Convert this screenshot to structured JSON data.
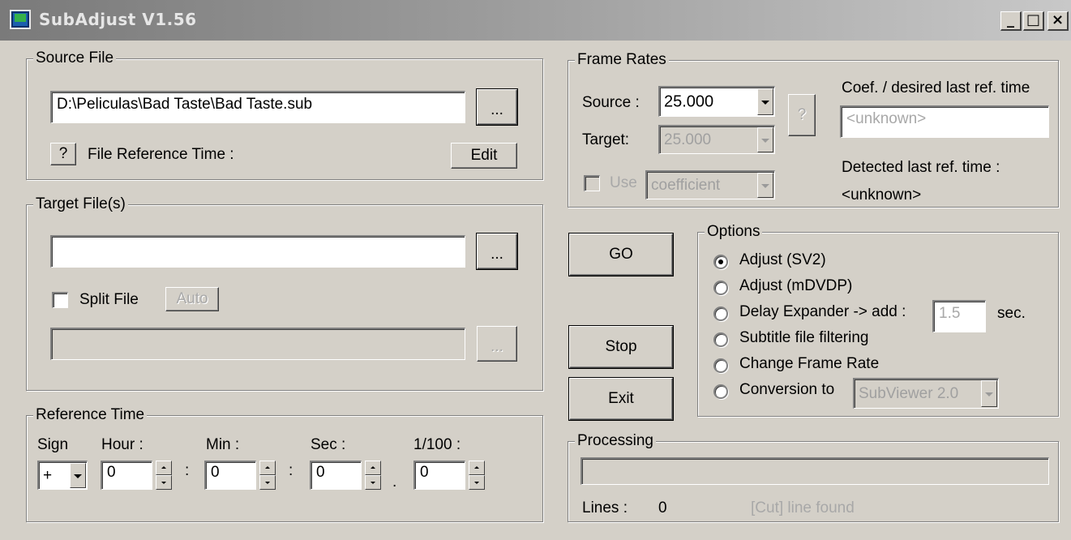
{
  "window": {
    "title": "SubAdjust V1.56",
    "minimize": "_",
    "maximize": "□",
    "close": "×"
  },
  "source_file": {
    "group_label": "Source File",
    "path": "D:\\Peliculas\\Bad Taste\\Bad Taste.sub",
    "browse_label": "...",
    "help_label": "?",
    "ref_time_label": "File Reference Time :",
    "edit_label": "Edit"
  },
  "target_files": {
    "group_label": "Target File(s)",
    "path": "",
    "browse_label": "...",
    "split_label": "Split File",
    "auto_label": "Auto",
    "split_path": "",
    "split_browse_label": "..."
  },
  "reference_time": {
    "group_label": "Reference Time",
    "sign_label": "Sign",
    "hour_label": "Hour :",
    "min_label": "Min :",
    "sec_label": "Sec :",
    "hund_label": "1/100 :",
    "sign_value": "+",
    "hour_value": "0",
    "min_value": "0",
    "sec_value": "0",
    "hund_value": "0",
    "sep1": ":",
    "sep2": ":",
    "sep3": "."
  },
  "frame_rates": {
    "group_label": "Frame Rates",
    "source_label": "Source :",
    "source_value": "25.000",
    "target_label": "Target:",
    "target_value": "25.000",
    "help_label": "?",
    "use_label": "Use",
    "use_value": "coefficient",
    "coef_label": "Coef. / desired last ref. time",
    "coef_value": "<unknown>",
    "detected_label": "Detected last ref. time :",
    "detected_value": "<unknown>"
  },
  "actions": {
    "go_label": "GO",
    "stop_label": "Stop",
    "exit_label": "Exit"
  },
  "options": {
    "group_label": "Options",
    "items": [
      {
        "label": "Adjust (SV2)",
        "checked": true
      },
      {
        "label": "Adjust (mDVDP)",
        "checked": false
      },
      {
        "label": "Delay Expander -> add :",
        "checked": false
      },
      {
        "label": "Subtitle file filtering",
        "checked": false
      },
      {
        "label": "Change Frame Rate",
        "checked": false
      },
      {
        "label": "Conversion to",
        "checked": false
      }
    ],
    "delay_value": "1.5",
    "delay_unit": "sec.",
    "conversion_value": "SubViewer 2.0"
  },
  "processing": {
    "group_label": "Processing",
    "progress": 0,
    "lines_label": "Lines :",
    "lines_value": "0",
    "cut_label": "[Cut] line found"
  }
}
